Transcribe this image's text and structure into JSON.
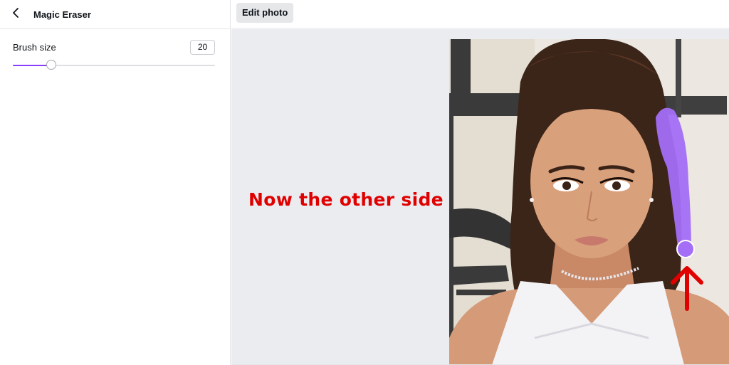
{
  "sidebar": {
    "title": "Magic Eraser",
    "brush": {
      "label": "Brush size",
      "value": "20",
      "slider_fraction": 0.19
    }
  },
  "topbar": {
    "edit_label": "Edit photo"
  },
  "canvas": {
    "annotation": "Now the other side",
    "colors": {
      "annotation": "#e00000",
      "brush_stroke": "#a46ef7",
      "accent": "#8b3dff"
    }
  },
  "icons": {
    "back": "chevron-left-icon",
    "arrow": "arrow-up-icon"
  }
}
